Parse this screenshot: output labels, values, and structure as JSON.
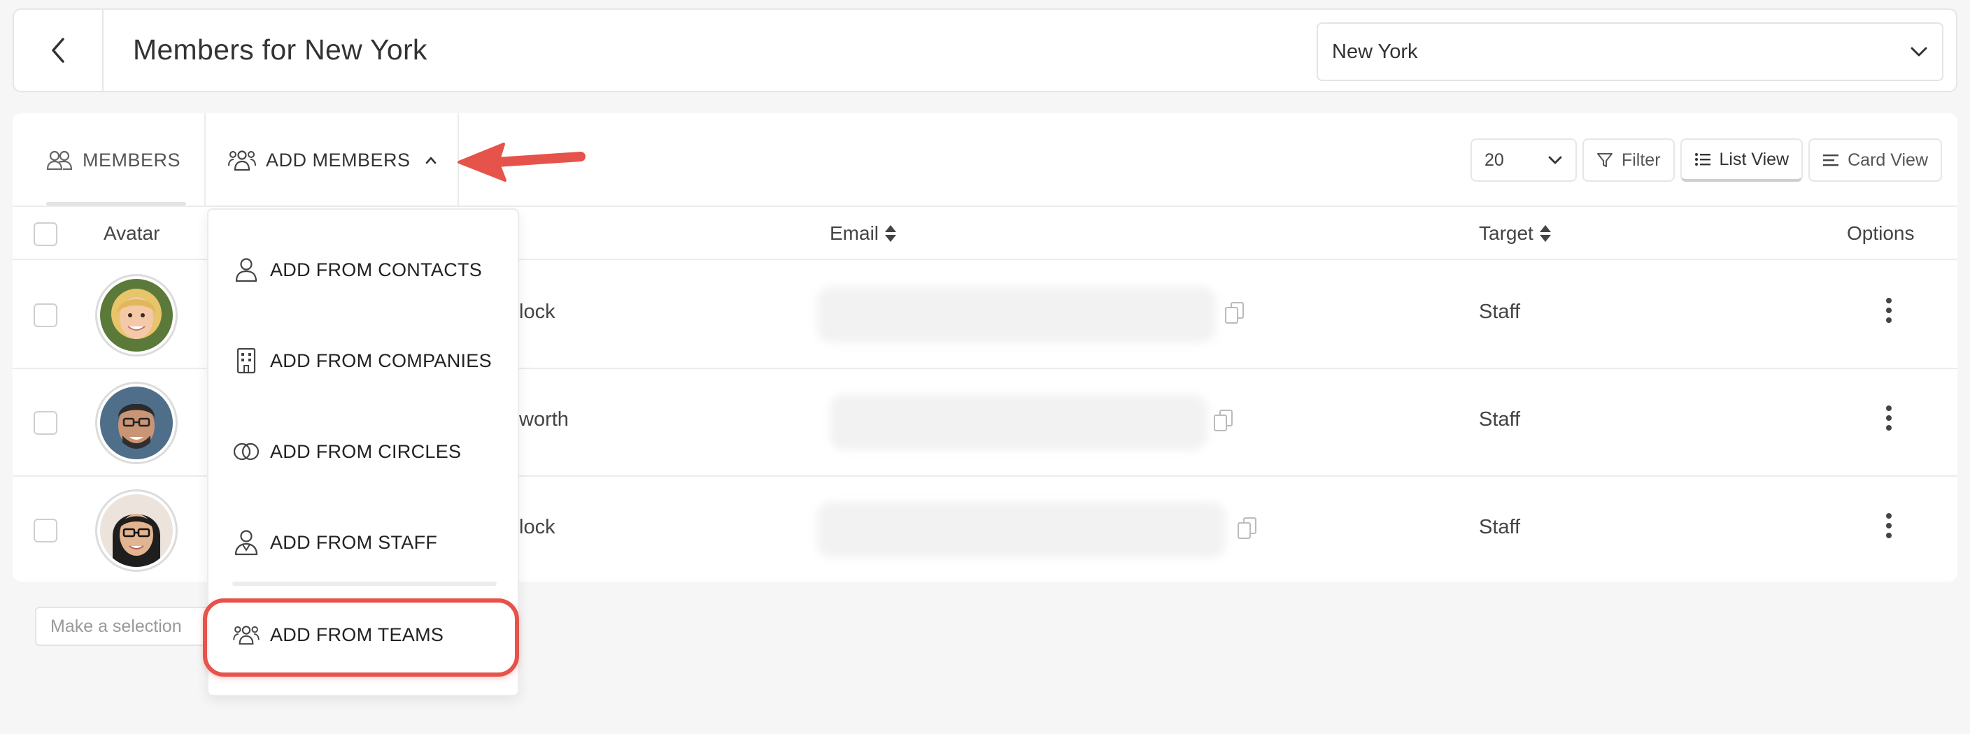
{
  "header": {
    "title": "Members for New York",
    "location_value": "New York"
  },
  "tabs": {
    "members": "MEMBERS",
    "add_members": "ADD MEMBERS"
  },
  "toolbar": {
    "page_size": "20",
    "filter": "Filter",
    "list_view": "List View",
    "card_view": "Card View"
  },
  "table": {
    "columns": {
      "avatar": "Avatar",
      "email": "Email",
      "target": "Target",
      "options": "Options"
    },
    "rows": [
      {
        "name_fragment": "lock",
        "target": "Staff"
      },
      {
        "name_fragment": "worth",
        "target": "Staff"
      },
      {
        "name_fragment": "lock",
        "target": "Staff"
      }
    ]
  },
  "selection_placeholder": "Make a selection",
  "dropdown": {
    "items": [
      {
        "label": "ADD FROM CONTACTS",
        "icon": "person-icon"
      },
      {
        "label": "ADD FROM COMPANIES",
        "icon": "building-icon"
      },
      {
        "label": "ADD FROM CIRCLES",
        "icon": "circles-icon"
      },
      {
        "label": "ADD FROM STAFF",
        "icon": "staff-icon"
      },
      {
        "label": "ADD FROM TEAMS",
        "icon": "team-icon"
      }
    ]
  },
  "colors": {
    "highlight": "#e5534b",
    "text": "#333333",
    "border": "#e6e6e6"
  }
}
